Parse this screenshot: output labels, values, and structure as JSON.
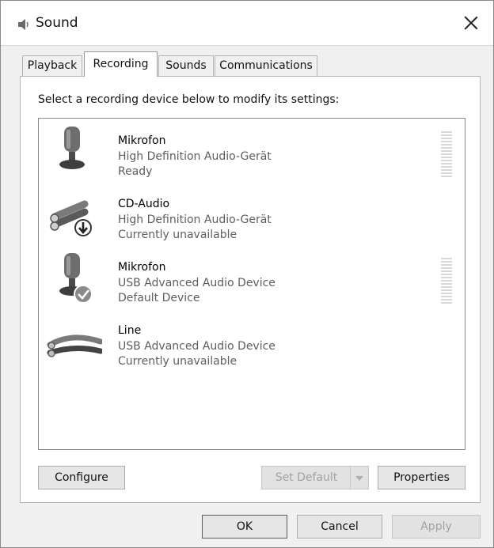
{
  "window": {
    "title": "Sound"
  },
  "tabs": [
    {
      "label": "Playback"
    },
    {
      "label": "Recording"
    },
    {
      "label": "Sounds"
    },
    {
      "label": "Communications"
    }
  ],
  "active_tab": "Recording",
  "instruction": "Select a recording device below to modify its settings:",
  "devices": [
    {
      "name": "Mikrofon",
      "description": "High Definition Audio-Gerät",
      "status": "Ready",
      "icon": "microphone-icon",
      "has_level_meter": true
    },
    {
      "name": "CD-Audio",
      "description": "High Definition Audio-Gerät",
      "status": "Currently unavailable",
      "icon": "rca-cable-icon",
      "badge": "unplugged-arrow-badge"
    },
    {
      "name": "Mikrofon",
      "description": "USB Advanced Audio Device",
      "status": "Default Device",
      "icon": "microphone-icon",
      "badge": "default-check-badge",
      "has_level_meter": true
    },
    {
      "name": "Line",
      "description": "USB Advanced Audio Device",
      "status": "Currently unavailable",
      "icon": "line-cable-icon"
    }
  ],
  "panel_buttons": {
    "configure": "Configure",
    "set_default": "Set Default",
    "properties": "Properties"
  },
  "dialog_buttons": {
    "ok": "OK",
    "cancel": "Cancel",
    "apply": "Apply"
  }
}
